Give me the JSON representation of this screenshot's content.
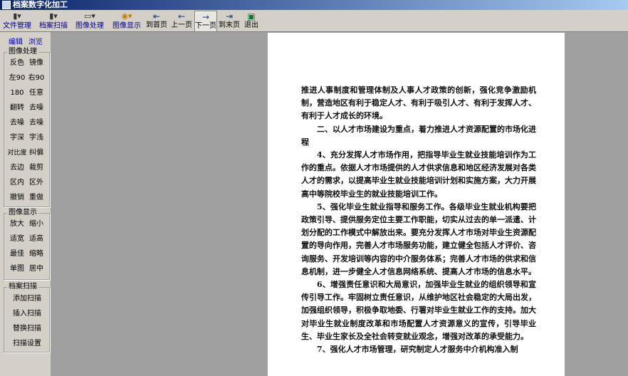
{
  "window": {
    "title": "档案数字化加工"
  },
  "toolbar": {
    "menus": [
      {
        "label": "文件管理",
        "icon": "file-icon"
      },
      {
        "label": "档案扫描",
        "icon": "scan-icon"
      },
      {
        "label": "图像处理",
        "icon": "image-icon"
      },
      {
        "label": "图像显示",
        "icon": "magnifier-icon"
      }
    ],
    "nav": {
      "first": "到首页",
      "prev": "上一页",
      "next": "下一页",
      "last": "到末页",
      "exit": "退出"
    }
  },
  "sidebar": {
    "tabs": {
      "edit": "编辑",
      "browse": "浏览"
    },
    "image_processing": {
      "title": "图像处理",
      "buttons": [
        "反色",
        "镜像",
        "左90",
        "右90",
        "180",
        "任意",
        "翻转",
        "去噪",
        "去噪",
        "去噪",
        "字深",
        "字浅",
        "对比度",
        "纠偏",
        "去边",
        "裁剪",
        "区内",
        "区外",
        "撤销",
        "重做"
      ]
    },
    "image_display": {
      "title": "图像显示",
      "buttons": [
        "放大",
        "缩小",
        "适宽",
        "适高",
        "最佳",
        "缩略",
        "单图",
        "居中"
      ]
    },
    "archive_scan": {
      "title": "档案扫描",
      "buttons": [
        "添加扫描",
        "插入扫描",
        "替换扫描",
        "扫描设置"
      ]
    }
  },
  "document": {
    "paragraphs": [
      {
        "indent": false,
        "text": "推进人事制度和管理体制及人事人才政策的创新，强化竞争激励机制，营造地区有利于稳定人才、有利于吸引人才、有利于发挥人才、有利于人才成长的环境。"
      },
      {
        "indent": true,
        "text": "二、以人才市场建设为重点，着力推进人才资源配置的市场化进程"
      },
      {
        "indent": true,
        "text": "4、充分发挥人才市场作用，把指导毕业生就业技能培训作为工作的重点。依据人才市场提供的人才供求信息和地区经济发展对各类人才的需求，以提高毕业生就业技能培训计划和实施方案，大力开展高中等院校毕业生的就业技能培训工作。"
      },
      {
        "indent": true,
        "text": "5、强化毕业生就业指导和服务工作。各级毕业生就业机构要把政策引导、提供服务定位主要工作职能，切实从过去的单一派遣、计划分配的工作模式中解放出来。要充分发挥人才市场对毕业生资源配置的导向作用，完善人才市场服务功能，建立健全包括人才评价、咨询服务、开发培训等内容的中介服务体系；完善人才市场的供求和信息机制，进一步健全人才信息网络系统、提高人才市场的信息水平。"
      },
      {
        "indent": true,
        "text": "6、增强责任意识和大局意识，加强毕业生就业的组织领导和宣传引导工作。牢固树立责任意识，从维护地区社会稳定的大局出发，加强组织领导，积极争取地委、行署对毕业生就业工作的支持。加大对毕业生就业制度改革和市场配置人才资源意义的宣传，引导毕业生、毕业生家长及全社会转变就业观念，增强对改革的承受能力。"
      },
      {
        "indent": true,
        "text": "7、强化人才市场管理，研究制定人才服务中介机构准入制"
      }
    ]
  }
}
